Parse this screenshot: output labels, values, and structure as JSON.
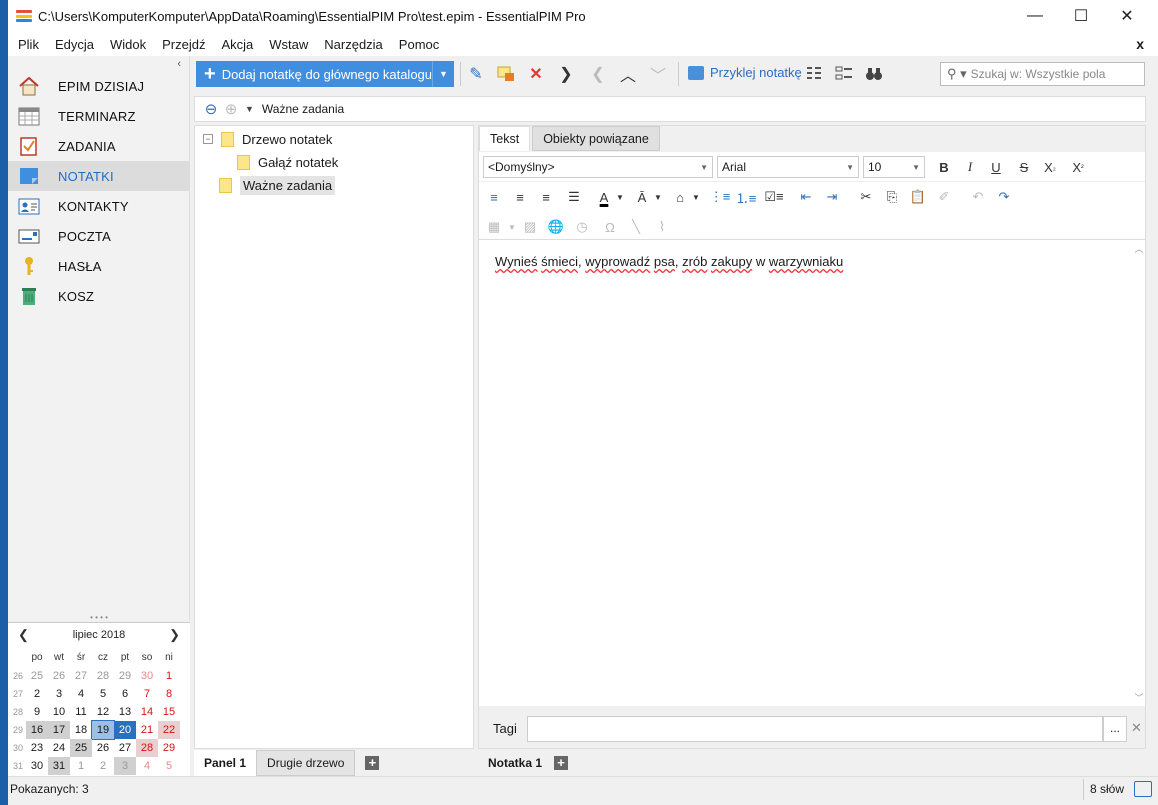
{
  "window": {
    "title": "C:\\Users\\KomputerKomputer\\AppData\\Roaming\\EssentialPIM Pro\\test.epim - EssentialPIM Pro",
    "minimize_glyph": "—",
    "maximize_glyph": "☐",
    "close_glyph": "✕"
  },
  "menu": [
    "Plik",
    "Edycja",
    "Widok",
    "Przejdź",
    "Akcja",
    "Wstaw",
    "Narzędzia",
    "Pomoc"
  ],
  "menu_close": "x",
  "sidebar": {
    "collapse_glyph": "‹",
    "items": [
      {
        "label": "EPIM DZISIAJ",
        "icon": "home-icon"
      },
      {
        "label": "TERMINARZ",
        "icon": "calendar-icon"
      },
      {
        "label": "ZADANIA",
        "icon": "tasks-icon"
      },
      {
        "label": "NOTATKI",
        "icon": "notes-icon"
      },
      {
        "label": "KONTAKTY",
        "icon": "contacts-icon"
      },
      {
        "label": "POCZTA",
        "icon": "mail-icon"
      },
      {
        "label": "HASŁA",
        "icon": "key-icon"
      },
      {
        "label": "KOSZ",
        "icon": "trash-icon"
      }
    ],
    "selected_index": 3
  },
  "calendar": {
    "month": "lipiec",
    "year": "2018",
    "day_headers": [
      "po",
      "wt",
      "śr",
      "cz",
      "pt",
      "so",
      "ni"
    ],
    "weeks": [
      {
        "wk": "26",
        "days": [
          "25",
          "26",
          "27",
          "28",
          "29",
          "30",
          "1"
        ]
      },
      {
        "wk": "27",
        "days": [
          "2",
          "3",
          "4",
          "5",
          "6",
          "7",
          "8"
        ]
      },
      {
        "wk": "28",
        "days": [
          "9",
          "10",
          "11",
          "12",
          "13",
          "14",
          "15"
        ]
      },
      {
        "wk": "29",
        "days": [
          "16",
          "17",
          "18",
          "19",
          "20",
          "21",
          "22"
        ]
      },
      {
        "wk": "30",
        "days": [
          "23",
          "24",
          "25",
          "26",
          "27",
          "28",
          "29"
        ]
      },
      {
        "wk": "31",
        "days": [
          "30",
          "31",
          "1",
          "2",
          "3",
          "4",
          "5"
        ]
      }
    ]
  },
  "toolbar": {
    "add_label": "Dodaj notatkę do głównego katalogu",
    "paste_label": "Przyklej notatkę",
    "search_placeholder": "Szukaj w: Wszystkie pola"
  },
  "address": {
    "path": "Ważne zadania"
  },
  "tree": {
    "nodes": [
      {
        "label": "Drzewo notatek",
        "expander": "−"
      },
      {
        "label": "Gałąź notatek"
      },
      {
        "label": "Ważne zadania"
      }
    ],
    "tabs": [
      "Panel 1",
      "Drugie drzewo"
    ]
  },
  "editor": {
    "tabs": [
      "Tekst",
      "Obiekty powiązane"
    ],
    "style": "<Domyślny>",
    "font": "Arial",
    "size": "10",
    "text_parts": [
      "Wynieś",
      " ",
      "śmieci",
      ", ",
      "wyprowadź",
      " ",
      "psa",
      ", ",
      "zrób",
      " ",
      "zakupy",
      " w ",
      "warzywniaku"
    ],
    "tags_label": "Tagi",
    "tags_dots": "...",
    "note_tabs": [
      "Notatka 1"
    ]
  },
  "status": {
    "left": "Pokazanych: 3",
    "right": "8 słów"
  },
  "colors": {
    "accent": "#3f8ee0",
    "selected_text": "#1b6fc9",
    "today": "#2a70c0"
  }
}
